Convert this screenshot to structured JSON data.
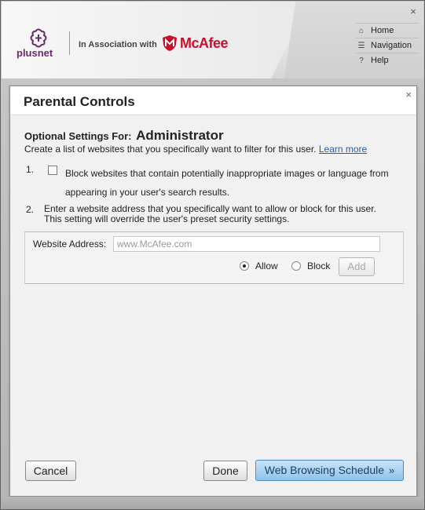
{
  "header": {
    "brand": "plusnet",
    "association": "In Association with",
    "partner": "McAfee",
    "window_close": "×"
  },
  "topnav": {
    "items": [
      {
        "label": "Home",
        "icon": "home-icon"
      },
      {
        "label": "Navigation",
        "icon": "list-icon"
      },
      {
        "label": "Help",
        "icon": "help-icon"
      }
    ]
  },
  "dialog": {
    "title": "Parental Controls",
    "close": "×",
    "optional_prefix": "Optional Settings For:",
    "user_name": "Administrator",
    "description": "Create a list of websites that you specifically want to filter for this user.",
    "learn_more": "Learn more",
    "step1": {
      "number": "1.",
      "text": "Block websites that contain potentially inappropriate images or language from appearing in your user's search results.",
      "checked": false
    },
    "step2": {
      "number": "2.",
      "line1": "Enter a website address that you specifically want to allow or block for this user.",
      "line2": "This setting will override the user's preset security settings."
    },
    "address": {
      "label": "Website Address:",
      "placeholder": "www.McAfee.com",
      "value": ""
    },
    "radio": {
      "allow": "Allow",
      "block": "Block",
      "selected": "allow"
    },
    "add_button": "Add",
    "cancel_button": "Cancel",
    "done_button": "Done",
    "schedule_button": "Web Browsing Schedule",
    "schedule_chevron": "»"
  },
  "colors": {
    "brand_purple": "#6b2a6b",
    "mcafee_red": "#c8102e",
    "link_blue": "#2a5aa8",
    "schedule_button_blue": "#8fc3ea"
  }
}
